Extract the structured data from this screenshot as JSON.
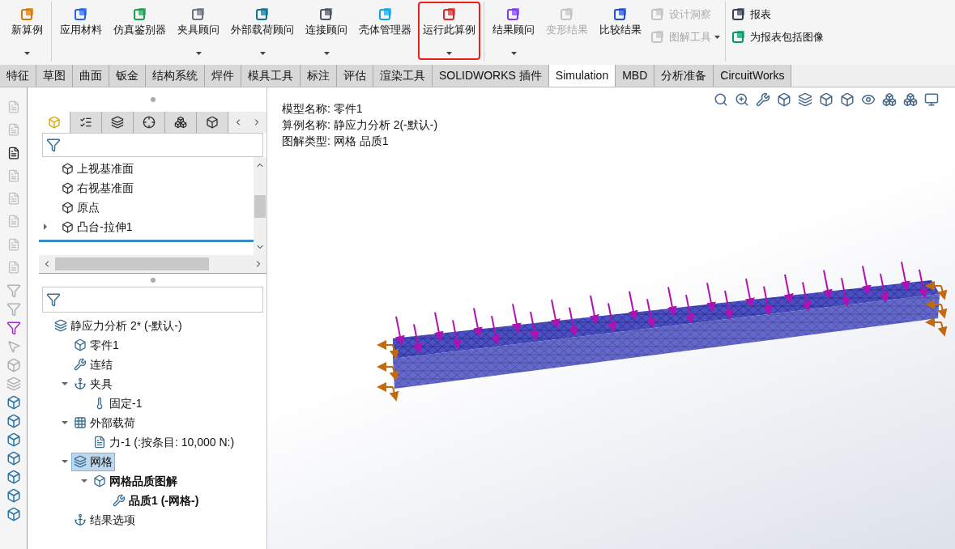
{
  "ribbon": {
    "groups": [
      {
        "items": [
          {
            "kind": "large",
            "label": "新算例",
            "has_menu": true,
            "disabled": false,
            "highlighted": false
          }
        ]
      },
      {
        "items": [
          {
            "kind": "large",
            "label": "应用材料",
            "has_menu": false,
            "disabled": false,
            "highlighted": false
          },
          {
            "kind": "large",
            "label": "仿真鉴别器",
            "has_menu": false,
            "disabled": false,
            "highlighted": false
          },
          {
            "kind": "large",
            "label": "夹具顾问",
            "has_menu": true,
            "disabled": false,
            "highlighted": false
          },
          {
            "kind": "large",
            "label": "外部载荷顾问",
            "has_menu": true,
            "disabled": false,
            "highlighted": false
          },
          {
            "kind": "large",
            "label": "连接顾问",
            "has_menu": true,
            "disabled": false,
            "highlighted": false
          },
          {
            "kind": "large",
            "label": "壳体管理器",
            "has_menu": false,
            "disabled": false,
            "highlighted": false
          },
          {
            "kind": "large",
            "label": "运行此算例",
            "has_menu": true,
            "disabled": false,
            "highlighted": true
          }
        ]
      },
      {
        "items": [
          {
            "kind": "large",
            "label": "结果顾问",
            "has_menu": true,
            "disabled": false,
            "highlighted": false
          },
          {
            "kind": "large",
            "label": "变形结果",
            "has_menu": false,
            "disabled": true,
            "highlighted": false
          },
          {
            "kind": "large",
            "label": "比较结果",
            "has_menu": false,
            "disabled": false,
            "highlighted": false
          },
          {
            "kind": "small",
            "label": "设计洞察",
            "has_menu": false,
            "disabled": true,
            "highlighted": false
          },
          {
            "kind": "small",
            "label": "图解工具",
            "has_menu": true,
            "disabled": true,
            "highlighted": false
          }
        ]
      },
      {
        "items": [
          {
            "kind": "small",
            "label": "报表",
            "has_menu": false,
            "disabled": false,
            "highlighted": false
          },
          {
            "kind": "small",
            "label": "为报表包括图像",
            "has_menu": false,
            "disabled": false,
            "highlighted": false
          }
        ]
      }
    ]
  },
  "tabs": [
    {
      "label": "特征",
      "selected": false
    },
    {
      "label": "草图",
      "selected": false
    },
    {
      "label": "曲面",
      "selected": false
    },
    {
      "label": "钣金",
      "selected": false
    },
    {
      "label": "结构系统",
      "selected": false
    },
    {
      "label": "焊件",
      "selected": false
    },
    {
      "label": "模具工具",
      "selected": false
    },
    {
      "label": "标注",
      "selected": false
    },
    {
      "label": "评估",
      "selected": false
    },
    {
      "label": "渲染工具",
      "selected": false
    },
    {
      "label": "SOLIDWORKS 插件",
      "selected": false
    },
    {
      "label": "Simulation",
      "selected": true
    },
    {
      "label": "MBD",
      "selected": false
    },
    {
      "label": "分析准备",
      "selected": false
    },
    {
      "label": "CircuitWorks",
      "selected": false
    }
  ],
  "panel_tabs": [
    {
      "selected": true
    },
    {
      "selected": false
    },
    {
      "selected": false
    },
    {
      "selected": false
    },
    {
      "selected": false
    },
    {
      "selected": false
    }
  ],
  "feature_tree": {
    "items": [
      {
        "label": "上视基准面"
      },
      {
        "label": "右视基准面"
      },
      {
        "label": "原点"
      },
      {
        "label": "凸台-拉伸1",
        "expanded": false
      }
    ]
  },
  "study_tree": {
    "items": [
      {
        "label": "静应力分析 2* (-默认-)",
        "selected": false,
        "bold": false,
        "children": [
          {
            "label": "零件1",
            "selected": false,
            "bold": false
          },
          {
            "label": "连结",
            "selected": false,
            "bold": false
          },
          {
            "label": "夹具",
            "expanded": true,
            "selected": false,
            "bold": false,
            "children": [
              {
                "label": "固定-1",
                "selected": false,
                "bold": false
              }
            ]
          },
          {
            "label": "外部载荷",
            "expanded": true,
            "selected": false,
            "bold": false,
            "children": [
              {
                "label": "力-1 (:按条目: 10,000 N:)",
                "selected": false,
                "bold": false
              }
            ]
          },
          {
            "label": "网格",
            "expanded": true,
            "selected": true,
            "bold": false,
            "children": [
              {
                "label": "网格品质图解",
                "expanded": true,
                "selected": false,
                "bold": true,
                "children": [
                  {
                    "label": "品质1 (-网格-)",
                    "selected": false,
                    "bold": true
                  }
                ]
              }
            ]
          },
          {
            "label": "结果选项",
            "selected": false,
            "bold": false
          }
        ]
      }
    ]
  },
  "viewport": {
    "info": [
      "模型名称: 零件1",
      "算例名称: 静应力分析 2(-默认-)",
      "图解类型: 网格 品质1"
    ]
  }
}
